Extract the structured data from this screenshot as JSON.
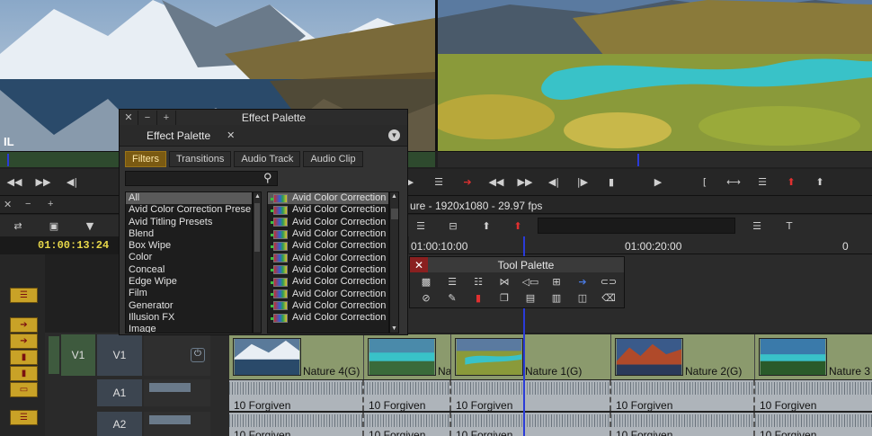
{
  "viewer_left": {
    "overlay_label": "IL"
  },
  "effect_palette": {
    "window_title": "Effect Palette",
    "tab_title": "Effect Palette",
    "tabs": [
      "Filters",
      "Transitions",
      "Audio Track",
      "Audio Clip"
    ],
    "active_tab": "Filters",
    "categories": [
      "All",
      "Avid Color Correction Prese",
      "Avid Titling Presets",
      "Blend",
      "Box Wipe",
      "Color",
      "Conceal",
      "Edge Wipe",
      "Film",
      "Generator",
      "Illusion FX",
      "Image"
    ],
    "selected_category": "All",
    "effects": [
      "Avid Color Correction",
      "Avid Color Correction",
      "Avid Color Correction",
      "Avid Color Correction",
      "Avid Color Correction",
      "Avid Color Correction",
      "Avid Color Correction",
      "Avid Color Correction",
      "Avid Color Correction",
      "Avid Color Correction",
      "Avid Color Correction"
    ]
  },
  "timeline": {
    "sequence_info": "ure - 1920x1080 - 29.97 fps",
    "timecode": "01:00:13:24",
    "ruler": [
      "01:00:10:00",
      "01:00:20:00"
    ],
    "tracks": {
      "v1_source": "V1",
      "v1_record": "V1",
      "a1": "A1",
      "a2": "A2"
    },
    "video_clips": [
      {
        "label": "Nature 4(G)"
      },
      {
        "label": "Na"
      },
      {
        "label": "Nature 1(G)"
      },
      {
        "label": "Nature 2(G)"
      },
      {
        "label": "Nature 3"
      }
    ],
    "audio_clips": [
      "10 Forgiven",
      "10 Forgiven",
      "10 Forgiven",
      "10 Forgiven",
      "10 Forgiven"
    ],
    "audio_clips_a2": [
      "10 Forgiven",
      "10 Forgiven",
      "10 Forgiven",
      "10 Forgiven",
      "10 Forgiven"
    ]
  },
  "tool_palette": {
    "title": "Tool Palette"
  },
  "colors": {
    "accent": "#c9a227",
    "timecode": "#e8d84a",
    "playhead": "#2a3bd8",
    "clip_video": "#8b9a6d",
    "clip_audio": "#aeb4ba"
  }
}
